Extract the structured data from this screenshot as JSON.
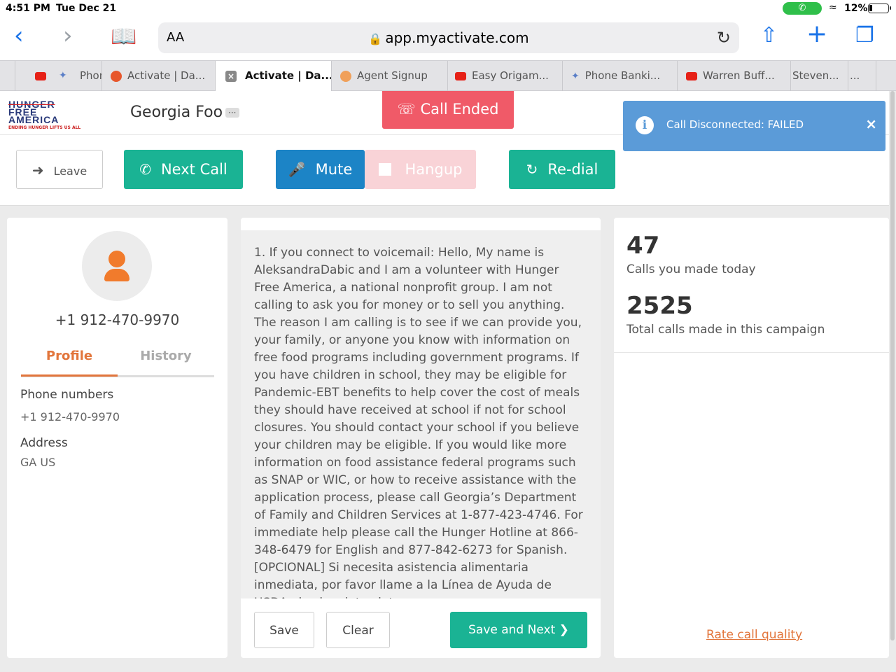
{
  "status": {
    "time": "4:51 PM",
    "date": "Tue Dec 21",
    "battery_pct": "12%",
    "battery_level": 0.12
  },
  "browser": {
    "reader_label": "AA",
    "url": "app.myactivate.com",
    "tabs": [
      {
        "label": "Phon",
        "icon": "twitter-like-icon"
      },
      {
        "label": "Activate | Da...",
        "icon": "activate-icon"
      },
      {
        "label": "Activate | Da...",
        "icon": "close-icon",
        "active": true
      },
      {
        "label": "Agent Signup",
        "icon": "agent-icon"
      },
      {
        "label": "Easy Origam...",
        "icon": "youtube-icon"
      },
      {
        "label": "Phone Banki...",
        "icon": "twitter-like-icon"
      },
      {
        "label": "Warren Buff...",
        "icon": "youtube-icon"
      },
      {
        "label": "Steven...",
        "icon": ""
      },
      {
        "label": "...",
        "icon": ""
      }
    ]
  },
  "header": {
    "logo_lines": [
      "HUNGER",
      "FREE",
      "AMERICA",
      "ENDING HUNGER LIFTS US ALL"
    ],
    "campaign_title": "Georgia Foo",
    "more_label": "···",
    "call_status": "Call Ended",
    "alert_text": "Call Disconnected: FAILED",
    "alert_close": "×"
  },
  "controls": {
    "leave": "Leave",
    "next_call": "Next Call",
    "mute": "Mute",
    "hangup": "Hangup",
    "redial": "Re-dial"
  },
  "contact": {
    "phone": "+1 912-470-9970",
    "tab_profile": "Profile",
    "tab_history": "History",
    "phone_label": "Phone numbers",
    "phone_value": "+1 912-470-9970",
    "address_label": "Address",
    "address_value": "GA US"
  },
  "script": {
    "text": "1. If you connect to voicemail:  Hello,   My name is AleksandraDabic and I am a volunteer with Hunger Free America, a national nonprofit group. I am not calling to ask you for money or to sell you anything. The reason I am calling is to see if we can provide you, your family, or anyone you know with information on free food programs including government programs.  If you have children in school, they may be eligible for Pandemic-EBT benefits to help cover the cost of meals they should have received at school if not for school closures. You should contact your school if you believe your children may be eligible.  If you would like more information on food assistance federal programs such as SNAP or WIC, or how to receive assistance with the application process, please call Georgia’s Department of Family and Children Services at 1-877-423-4746. For immediate help please call the Hunger Hotline at 866-348-6479 for English and 877-842-6273 for Spanish.   [OPCIONAL] Si necesita asistencia alimentaria inmediata, por favor llame a la Línea de Ayuda de USDA al ocho-siete-siete-",
    "save": "Save",
    "clear": "Clear",
    "save_next": "Save and Next"
  },
  "stats": {
    "calls_today": "47",
    "calls_today_label": "Calls you made today",
    "calls_total": "2525",
    "calls_total_label": "Total calls made in this campaign",
    "rate_link": "Rate call quality"
  },
  "colors": {
    "green": "#1ab394",
    "blue": "#1c84c6",
    "red": "#f05a68",
    "orange": "#e2753b",
    "alert_blue": "#5b9bd8"
  }
}
